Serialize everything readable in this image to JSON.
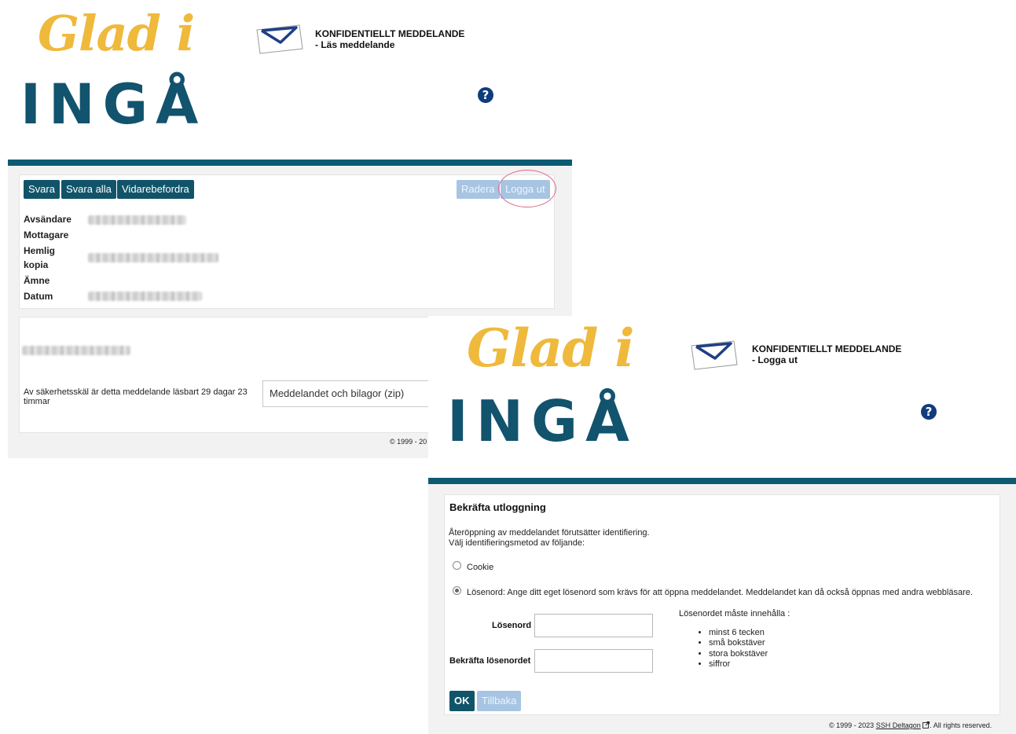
{
  "screen1": {
    "logo": {
      "line1": "Glad i",
      "line2": "INGÅ"
    },
    "header": {
      "title": "KONFIDENTIELLT MEDDELANDE",
      "subtitle": "- Läs meddelande"
    },
    "toolbar": {
      "reply": "Svara",
      "reply_all": "Svara alla",
      "forward": "Vidarebefordra",
      "delete": "Radera",
      "logout": "Logga ut"
    },
    "fields": {
      "sender": "Avsändare",
      "recipient": "Mottagare",
      "bcc_1": "Hemlig",
      "bcc_2": "kopia",
      "subject": "Ämne",
      "date": "Datum"
    },
    "security_note": "Av säkerhetsskäl är detta meddelande läsbart 29 dagar 23 timmar",
    "attachment_select": "Meddelandet och bilagor (zip)",
    "footer": "© 1999 - 20"
  },
  "screen2": {
    "logo": {
      "line1": "Glad i",
      "line2": "INGÅ"
    },
    "header": {
      "title": "KONFIDENTIELLT MEDDELANDE",
      "subtitle": "- Logga ut"
    },
    "heading": "Bekräfta utloggning",
    "intro_line1": "Återöppning av meddelandet förutsätter identifiering.",
    "intro_line2": "Välj identifieringsmetod av följande:",
    "option_cookie": "Cookie",
    "option_password": "Lösenord: Ange ditt eget lösenord som krävs för att öppna meddelandet. Meddelandet kan då också öppnas med andra webbläsare.",
    "password_label": "Lösenord",
    "confirm_label": "Bekräfta lösenordet",
    "requirements_title": "Lösenordet måste innehålla :",
    "requirements": [
      "minst 6 tecken",
      "små bokstäver",
      "stora bokstäver",
      "siffror"
    ],
    "ok": "OK",
    "back": "Tillbaka",
    "footer_prefix": "© 1999 - 2023",
    "footer_link": "SSH Deltagon",
    "footer_suffix": ". All rights reserved.",
    "selected_option": "password"
  },
  "help_glyph": "?",
  "colors": {
    "teal": "#0c5b72",
    "button": "#11546a",
    "button_disabled": "#a7c5e3",
    "logo_gold": "#efb93c",
    "logo_blue": "#12536e",
    "highlight": "#e06a8c"
  }
}
